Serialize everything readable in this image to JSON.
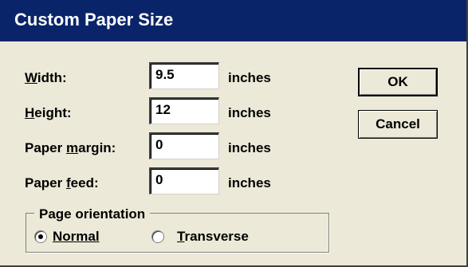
{
  "dialog": {
    "title": "Custom Paper Size"
  },
  "fields": [
    {
      "label": "Width:",
      "value": "9.5",
      "unit": "inches"
    },
    {
      "label": "Height:",
      "value": "12",
      "unit": "inches"
    },
    {
      "label": "Paper margin:",
      "value": "0",
      "unit": "inches"
    },
    {
      "label": "Paper feed:",
      "value": "0",
      "unit": "inches"
    }
  ],
  "buttons": {
    "ok": "OK",
    "cancel": "Cancel"
  },
  "orientation": {
    "group_label": "Page orientation",
    "options": [
      {
        "label": "Normal",
        "selected": true
      },
      {
        "label": "Transverse",
        "selected": false
      }
    ]
  }
}
